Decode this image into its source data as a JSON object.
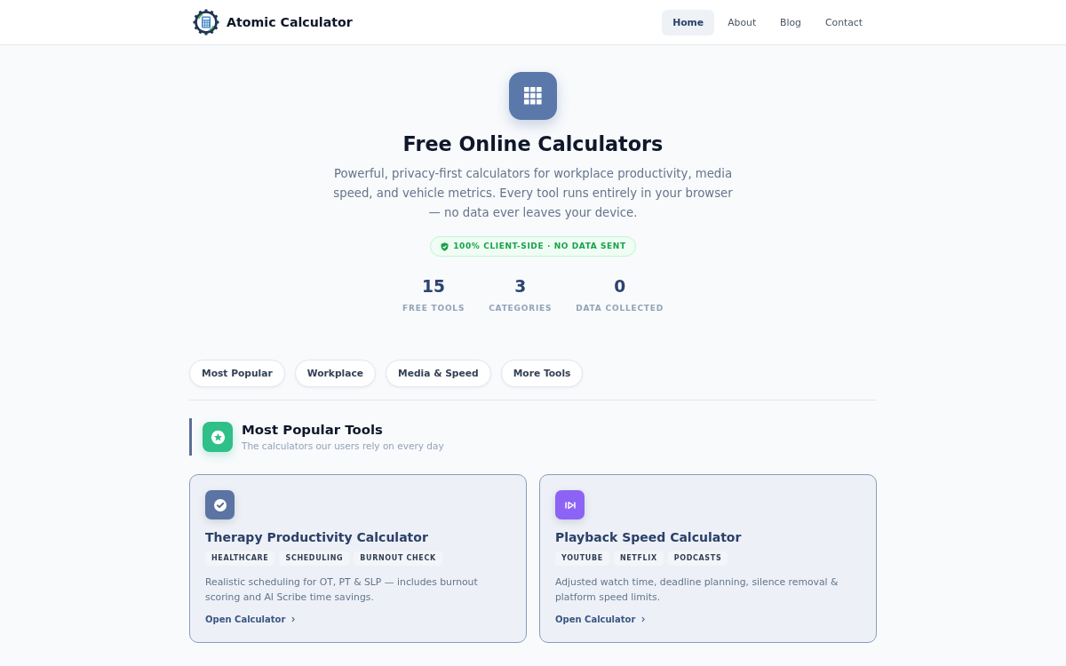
{
  "header": {
    "brand": "Atomic Calculator",
    "nav": [
      {
        "label": "Home",
        "selected": true
      },
      {
        "label": "About",
        "selected": false
      },
      {
        "label": "Blog",
        "selected": false
      },
      {
        "label": "Contact",
        "selected": false
      }
    ]
  },
  "hero": {
    "title": "Free Online Calculators",
    "description": "Powerful, privacy-first calculators for workplace productivity, media speed, and vehicle metrics. Every tool runs entirely in your browser — no data ever leaves your device.",
    "badge": "100% CLIENT-SIDE · NO DATA SENT",
    "stats": [
      {
        "value": "15",
        "label": "FREE TOOLS"
      },
      {
        "value": "3",
        "label": "CATEGORIES"
      },
      {
        "value": "0",
        "label": "DATA COLLECTED"
      }
    ]
  },
  "category_links": [
    "Most Popular",
    "Workplace",
    "Media & Speed",
    "More Tools"
  ],
  "section": {
    "title": "Most Popular Tools",
    "subtitle": "The calculators our users rely on every day",
    "cards": [
      {
        "title": "Therapy Productivity Calculator",
        "color": "#5b74a3",
        "tags": [
          "HEALTHCARE",
          "SCHEDULING",
          "BURNOUT CHECK"
        ],
        "description": "Realistic scheduling for OT, PT & SLP — includes burnout scoring and AI Scribe time savings.",
        "link": "Open Calculator"
      },
      {
        "title": "Playback Speed Calculator",
        "color": "#8d63f5",
        "tags": [
          "YOUTUBE",
          "NETFLIX",
          "PODCASTS"
        ],
        "description": "Adjusted watch time, deadline planning, silence removal & platform speed limits.",
        "link": "Open Calculator"
      }
    ]
  }
}
